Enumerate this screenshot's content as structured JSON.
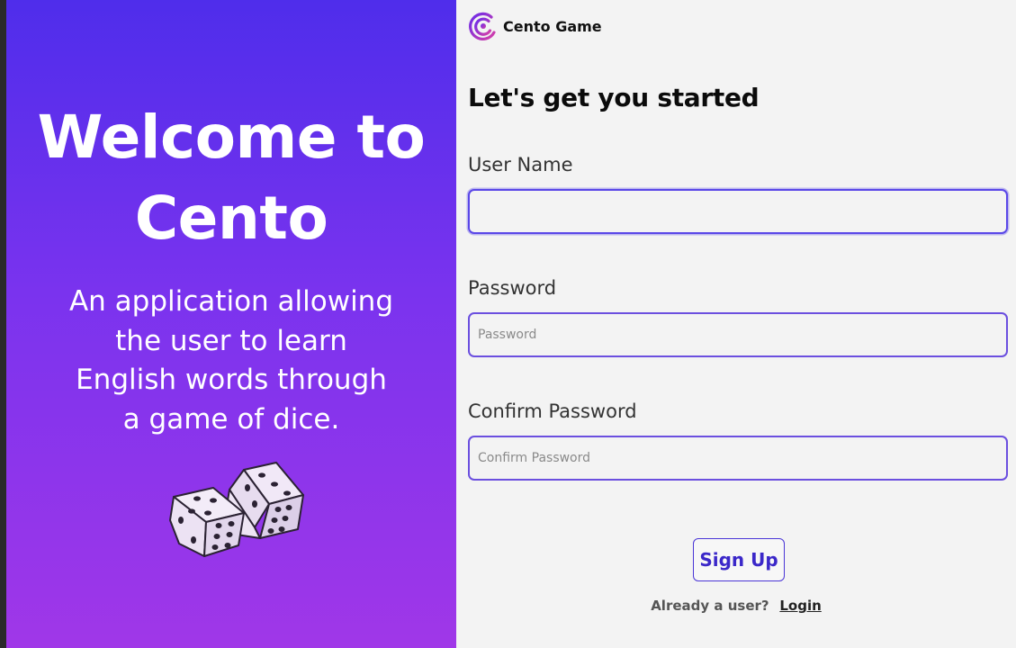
{
  "hero": {
    "title_line1": "Welcome to",
    "title_line2": "Cento",
    "subtitle_lines": [
      "An application allowing",
      "the user to learn",
      "English words through",
      "a game of dice."
    ],
    "dice_icon": "dice-icon"
  },
  "brand": {
    "name": "Cento Game",
    "logo_icon": "cento-logo-icon"
  },
  "form": {
    "heading": "Let's get you started",
    "username": {
      "label": "User Name",
      "value": "",
      "placeholder": ""
    },
    "password": {
      "label": "Password",
      "value": "",
      "placeholder": "Password"
    },
    "confirm_password": {
      "label": "Confirm Password",
      "value": "",
      "placeholder": "Confirm Password"
    },
    "signup_label": "Sign Up",
    "login_prompt": "Already a user?",
    "login_link": "Login"
  },
  "colors": {
    "gradient_top": "#4f2deb",
    "gradient_bottom": "#a037e8",
    "accent": "#4a35d6",
    "input_border": "#6b4fdf",
    "panel_bg": "#f3f3f3"
  }
}
